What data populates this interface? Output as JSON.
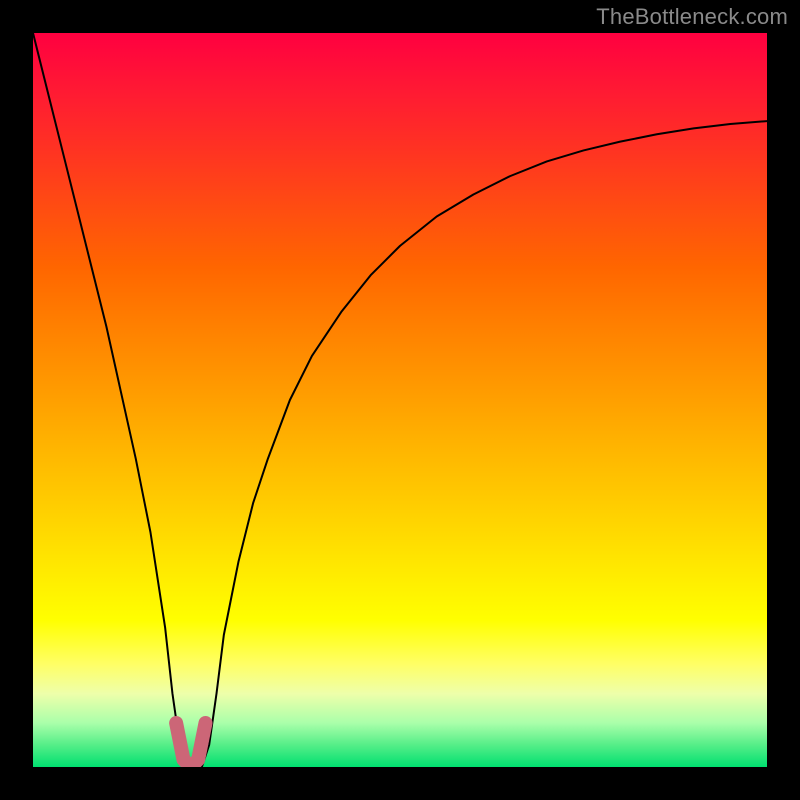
{
  "watermark": {
    "text": "TheBottleneck.com"
  },
  "chart_data": {
    "type": "line",
    "title": "",
    "xlabel": "",
    "ylabel": "",
    "xlim": [
      0,
      100
    ],
    "ylim": [
      0,
      100
    ],
    "grid": false,
    "legend": false,
    "background": "heat-gradient",
    "series": [
      {
        "name": "bottleneck-curve",
        "color": "#000000",
        "x": [
          0,
          2,
          4,
          6,
          8,
          10,
          12,
          14,
          16,
          18,
          19,
          20,
          21,
          22,
          23,
          24,
          25,
          26,
          28,
          30,
          32,
          35,
          38,
          42,
          46,
          50,
          55,
          60,
          65,
          70,
          75,
          80,
          85,
          90,
          95,
          100
        ],
        "y": [
          100,
          92,
          84,
          76,
          68,
          60,
          51,
          42,
          32,
          19,
          10,
          3,
          0,
          0,
          0,
          3,
          10,
          18,
          28,
          36,
          42,
          50,
          56,
          62,
          67,
          71,
          75,
          78,
          80.5,
          82.5,
          84,
          85.2,
          86.2,
          87,
          87.6,
          88
        ]
      },
      {
        "name": "highlight-valley",
        "color": "#cc6677",
        "stroke_width": 14,
        "x": [
          19.5,
          20.5,
          21.5,
          22.5,
          23.5
        ],
        "y": [
          6,
          1,
          0,
          1,
          6
        ]
      }
    ]
  }
}
